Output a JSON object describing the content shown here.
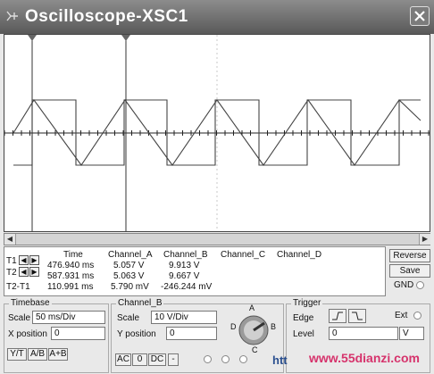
{
  "window": {
    "title": "Oscilloscope-XSC1",
    "close_icon": "close-icon"
  },
  "readout": {
    "headers": [
      "Time",
      "Channel_A",
      "Channel_B",
      "Channel_C",
      "Channel_D"
    ],
    "rows": [
      {
        "label": "T1",
        "time": "476.940 ms",
        "a": "5.057 V",
        "b": "9.913 V"
      },
      {
        "label": "T2",
        "time": "587.931 ms",
        "a": "5.063 V",
        "b": "9.667 V"
      },
      {
        "label": "T2-T1",
        "time": "110.991 ms",
        "a": "5.790 mV",
        "b": "-246.244 mV"
      }
    ]
  },
  "buttons": {
    "reverse": "Reverse",
    "save": "Save",
    "gnd": "GND"
  },
  "timebase": {
    "title": "Timebase",
    "scale_label": "Scale",
    "scale_value": "50 ms/Div",
    "xpos_label": "X position",
    "xpos_value": "0",
    "modes": [
      "Y/T",
      "A/B",
      "A+B"
    ]
  },
  "channel_b": {
    "title": "Channel_B",
    "scale_label": "Scale",
    "scale_value": "10 V/Div",
    "ypos_label": "Y position",
    "ypos_value": "0",
    "coupling": [
      "AC",
      "0",
      "DC",
      "-"
    ],
    "knob_labels": [
      "A",
      "B",
      "C",
      "D"
    ]
  },
  "trigger": {
    "title": "Trigger",
    "edge_label": "Edge",
    "level_label": "Level",
    "level_value": "0",
    "level_unit": "V",
    "ext_label": "Ext",
    "edge_rising_icon": "rising-edge-icon",
    "edge_falling_icon": "falling-edge-icon"
  },
  "watermark": {
    "text": "www.55dianzi.com",
    "partial": "htt"
  },
  "colors": {
    "titlebar": "#6f6f6f",
    "screen_bg": "#ffffff",
    "trace": "#3a3a3a",
    "watermark": "#d6336c"
  }
}
